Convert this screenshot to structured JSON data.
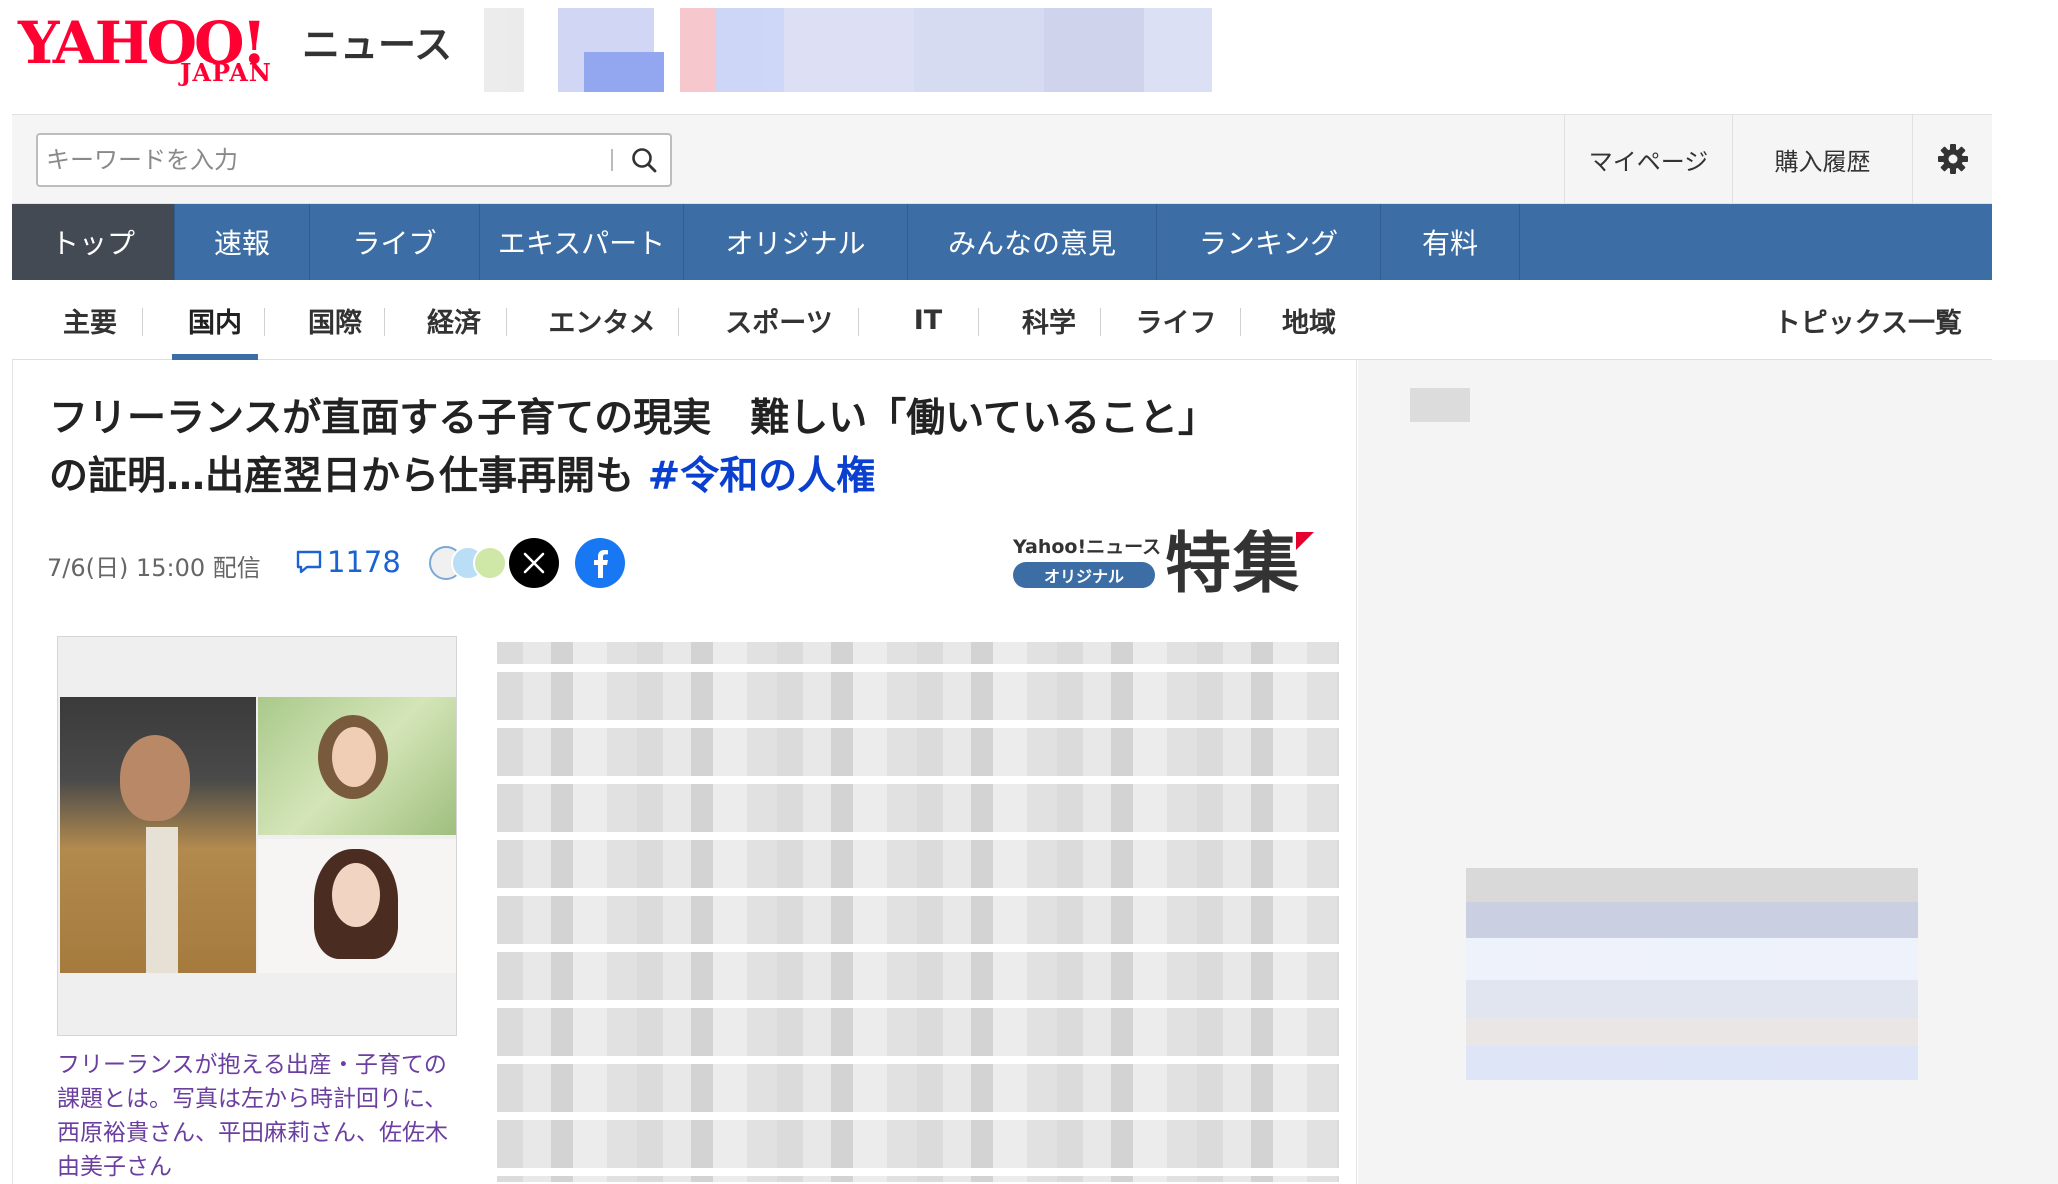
{
  "brand": {
    "logo_main": "YAHOO!",
    "logo_sub": "JAPAN",
    "service_name": "ニュース"
  },
  "search": {
    "placeholder": "キーワードを入力"
  },
  "header_links": {
    "mypage": "マイページ",
    "history": "購入履歴"
  },
  "main_nav": [
    {
      "label": "トップ",
      "active": true
    },
    {
      "label": "速報"
    },
    {
      "label": "ライブ"
    },
    {
      "label": "エキスパート"
    },
    {
      "label": "オリジナル"
    },
    {
      "label": "みんなの意見"
    },
    {
      "label": "ランキング"
    },
    {
      "label": "有料"
    }
  ],
  "sub_nav": [
    {
      "label": "主要"
    },
    {
      "label": "国内",
      "active": true
    },
    {
      "label": "国際"
    },
    {
      "label": "経済"
    },
    {
      "label": "エンタメ"
    },
    {
      "label": "スポーツ"
    },
    {
      "label": "IT"
    },
    {
      "label": "科学"
    },
    {
      "label": "ライフ"
    },
    {
      "label": "地域"
    }
  ],
  "topics_link": "トピックス一覧",
  "article": {
    "title_line1": "フリーランスが直面する子育ての現実　難しい「働いていること」",
    "title_line2": "の証明…出産翌日から仕事再開も",
    "hashtag": "#令和の人権",
    "date": "7/6(日) 15:00 配信",
    "comment_count": "1178",
    "badge_top": "Yahoo!ニュース",
    "badge_pill": "オリジナル",
    "badge_big": "特集",
    "photo_caption": "フリーランスが抱える出産・子育ての課題とは。写真は左から時計回りに、西原裕貴さん、平田麻莉さん、佐佐木由美子さん"
  },
  "colors": {
    "brand_red": "#ff0033",
    "nav_blue": "#3c6ea5",
    "nav_active": "#444a53",
    "hashtag_blue": "#0b3fcf",
    "caption_purple": "#6b3fa0",
    "facebook": "#1877f2"
  },
  "icons": {
    "search": "search-icon",
    "gear": "gear-icon",
    "comment": "comment-icon",
    "x": "x-logo-icon",
    "facebook": "facebook-logo-icon"
  }
}
